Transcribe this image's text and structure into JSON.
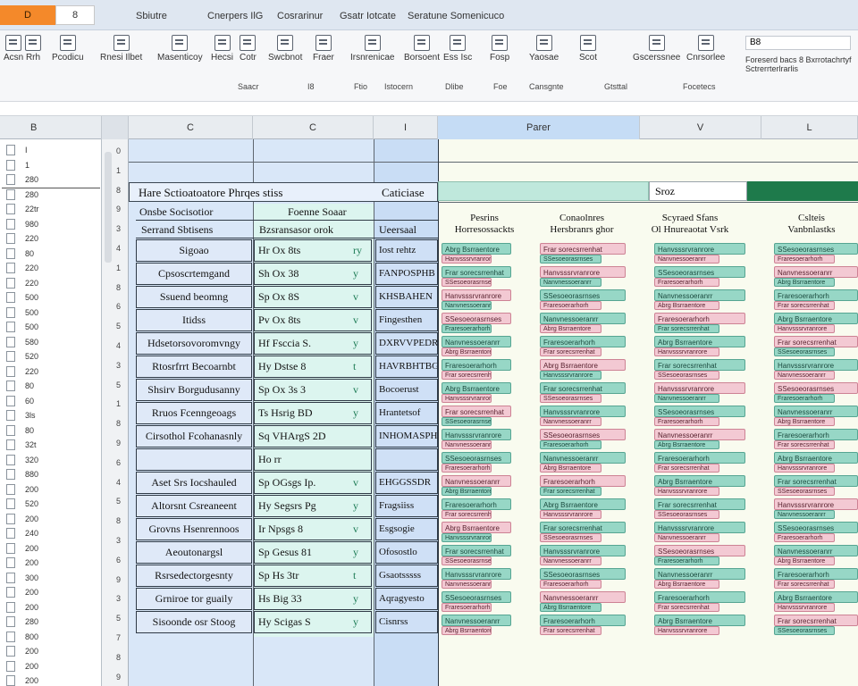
{
  "titlebar": {
    "app_badge": "D",
    "doc_box": "8",
    "tabs": [
      "Sbiutre",
      "Cnerpers IlG",
      "Cosrarinur",
      "Gsatr Iotcate",
      "Seratune Somenicuco"
    ]
  },
  "ribbon": {
    "buttons": [
      {
        "label": "Acsn"
      },
      {
        "label": "Rrh"
      },
      {
        "label": "Pcodicu"
      },
      {
        "label": "Rnesi Ilbet"
      },
      {
        "label": "Masenticoy"
      },
      {
        "label": "Hecsi"
      },
      {
        "label": "Cotr"
      },
      {
        "label": "Swcbnot"
      },
      {
        "label": "Fraer"
      },
      {
        "label": "Irsnrenicae"
      },
      {
        "label": "Borsoent"
      },
      {
        "label": "Ess Isc"
      },
      {
        "label": "Fosp"
      },
      {
        "label": "Yaosae"
      },
      {
        "label": "Scot"
      },
      {
        "label": "Gscerssnee"
      },
      {
        "label": "Cnrsorlee"
      }
    ],
    "groups": [
      "Saacr",
      "I8",
      "Ftio",
      "Istocern",
      "Dlibe",
      "Foe",
      "Cansgnte",
      "Gtsttal",
      "Focetecs"
    ],
    "name_box": "B8",
    "note_line1": "Foreserd bacs 8 Bxrrotachrtyf",
    "note_line2": "Sctrerrterlrarlis"
  },
  "columns": {
    "headers": [
      "B",
      "C",
      "C",
      "I",
      "Parer",
      "V",
      "L"
    ]
  },
  "row_strip": [
    "I",
    "1",
    "280",
    "280",
    "22tr",
    "980",
    "220",
    "80",
    "220",
    "220",
    "500",
    "500",
    "500",
    "580",
    "520",
    "220",
    "80",
    "60",
    "3ls",
    "80",
    "32t",
    "320",
    "880",
    "200",
    "520",
    "200",
    "240",
    "200",
    "200",
    "300",
    "200",
    "200",
    "280",
    "800",
    "200",
    "200",
    "200"
  ],
  "gutter": [
    "0",
    "1",
    "8",
    "9",
    "3",
    "4",
    "1",
    "8",
    "6",
    "5",
    "4",
    "3",
    "5",
    "1",
    "8",
    "9",
    "6",
    "4",
    "5",
    "8",
    "3",
    "6",
    "9",
    "3",
    "5",
    "7",
    "8",
    "9"
  ],
  "sheet": {
    "title": "Hare Sctioatoatore Phrqes stiss",
    "title_b": "Caticiase",
    "right_box": "Sroz",
    "header_left": "Onsbe Socisotior",
    "header_mid": "Foenne Soaar",
    "header_left2": "Serrand Sbtisens",
    "header_mid2": "Bzsransasor orok",
    "header_c3": "Ueersaal"
  },
  "rows": [
    {
      "label": "Sigoao",
      "val": "Hr  Ox  8ts",
      "mark": "ry",
      "c3": "Iost rehtz"
    },
    {
      "label": "Cpsoscrtemgand",
      "val": "Sh  Ox  38",
      "mark": "y",
      "c3": "FANPOSPHB"
    },
    {
      "label": "Ssuend beomng",
      "val": "Sp  Ox  8S",
      "mark": "v",
      "c3": "KHSBAHEN"
    },
    {
      "label": "Itidss",
      "val": "Pv  Ox  8ts",
      "mark": "v",
      "c3": "Fingesthen"
    },
    {
      "label": "Hdsetorsovoromvngy",
      "val": "Hf  Fsccia  S.",
      "mark": "y",
      "c3": "DXRVVPEDR"
    },
    {
      "label": "Rtosrfrrt Becoarnbt",
      "val": "Hy  Dstse  8",
      "mark": "t",
      "c3": "HAVRBHTBG"
    },
    {
      "label": "Shsirv Borgudusanny",
      "val": "Sp  Ox  3s  3",
      "mark": "v",
      "c3": "Bocoerust"
    },
    {
      "label": "Rruos Fcenngeoags",
      "val": "Ts  Hsrig  BD",
      "mark": "y",
      "c3": "Hrantetsof"
    },
    {
      "label": "Cirsothol Fcohanasnly",
      "val": "Sq  VHArgS  2D",
      "mark": "",
      "c3": "INHOMASPHS"
    },
    {
      "label": "",
      "val": "Ho  rr",
      "mark": "",
      "c3": ""
    },
    {
      "label": "Aset Srs Iocshauled",
      "val": "Sp  OGsgs  Ip.",
      "mark": "v",
      "c3": "EHGGSSDR"
    },
    {
      "label": "Altorsnt Csreaneent",
      "val": "Hy  Segsrs  Pg",
      "mark": "y",
      "c3": "Fragsiiss"
    },
    {
      "label": "Grovns Hsenrennoos",
      "val": "Ir  Npsgs  8",
      "mark": "v",
      "c3": "Esgsogie"
    },
    {
      "label": "Aeoutonargsl",
      "val": "Sp  Gesus  81",
      "mark": "y",
      "c3": "Ofosostlo"
    },
    {
      "label": "Rsrsedectorgesnty",
      "val": "Sp  Hs  3tr",
      "mark": "t",
      "c3": "Gsaotsssss"
    },
    {
      "label": "Grniroe tor guaily",
      "val": "Hs  Big  33",
      "mark": "y",
      "c3": "Aqragyesto"
    },
    {
      "label": "Sisoonde osr Stoog",
      "val": "Hy  Scigas  S",
      "mark": "y",
      "c3": "Cisnrss"
    }
  ],
  "right_headers": [
    {
      "l1": "Pesrins",
      "l2": "Horresossackts"
    },
    {
      "l1": "Conaolnres",
      "l2": "Hersbranrs ghor"
    },
    {
      "l1": "Scyraed Sfans",
      "l2": "Ol  Hnureaotat Vsrk"
    },
    {
      "l1": "Cslteis",
      "l2": "Vanbnlastks"
    }
  ],
  "pill_text": [
    "Abrg  Bsrraentore",
    "Frar sorecsrrenhat",
    "Hanvsssrvranrore",
    "SSesoeorasrnses",
    "Nanvnessoeranrr",
    "Fraresoerarhorh"
  ],
  "colors": {
    "teal": "#97d7c6",
    "pink": "#f3c9d3",
    "green": "#1e7a4b",
    "blue": "#d9e7f8",
    "accent": "#f4892a"
  }
}
